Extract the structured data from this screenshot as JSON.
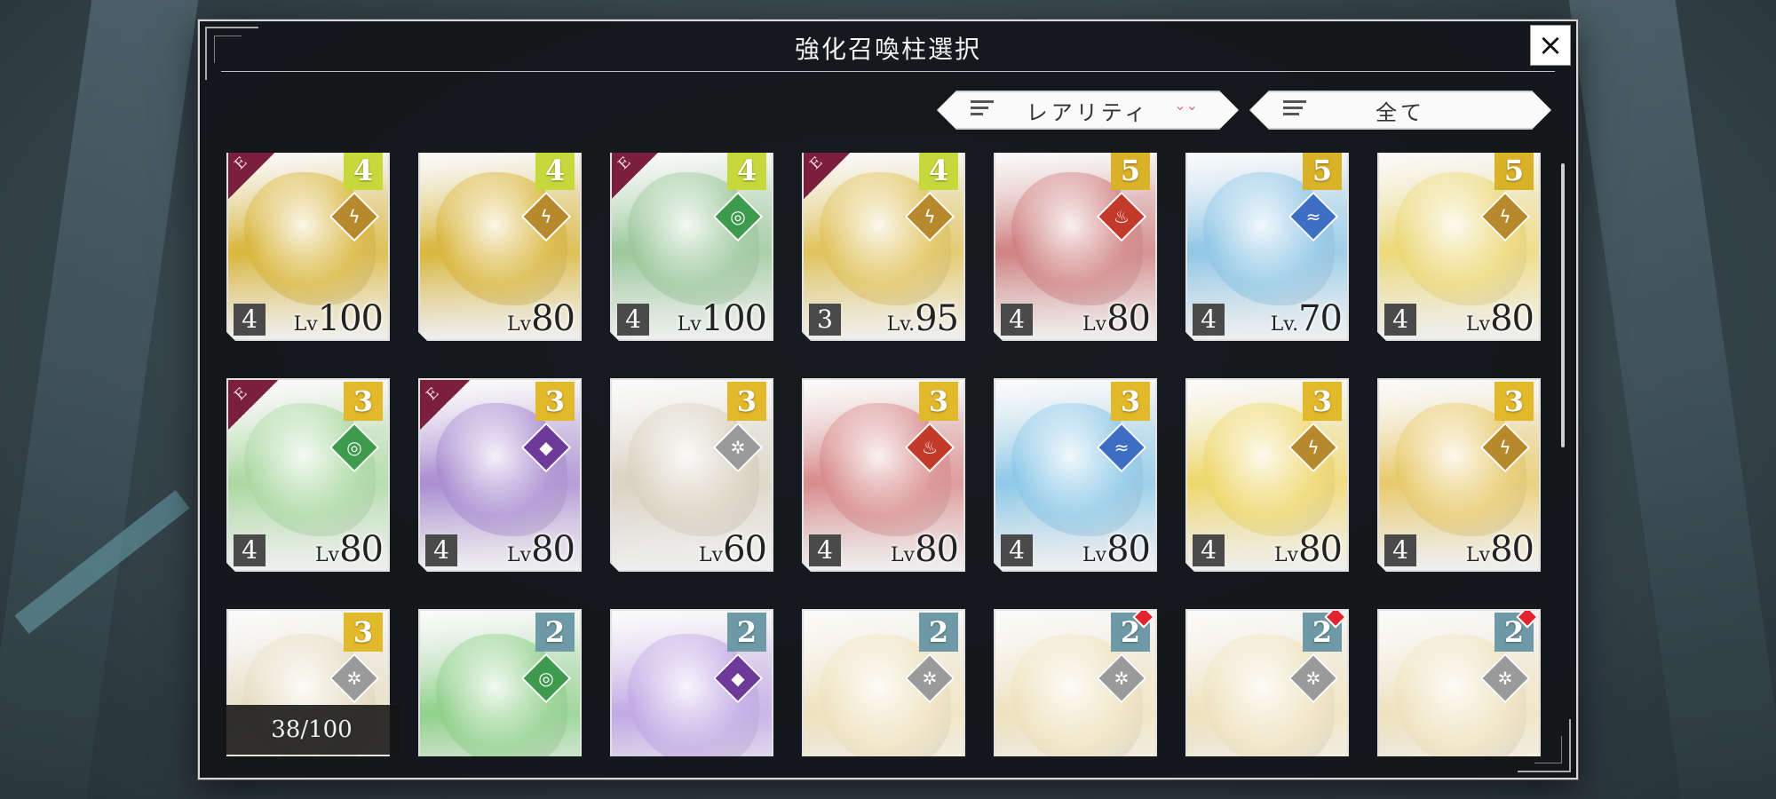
{
  "dialog": {
    "title": "強化召喚柱選択",
    "close_label": "×",
    "sort_label": "レアリティ",
    "sort_chevron": "⌄⌄",
    "filter_label": "全て",
    "counter": "38/100"
  },
  "colors": {
    "rarity4": "#c7d83a",
    "rarity5": "#d9b227",
    "rarity3": "#e3b92c",
    "rarity2": "#6e9aa7",
    "elem_thunder": "#b5892c",
    "elem_wind": "#3e9a4c",
    "elem_fire": "#c33a2b",
    "elem_water": "#3c6fc4",
    "elem_dark": "#6d3a9a",
    "elem_neutral": "#9a9a9a"
  },
  "cards": [
    {
      "rarity": "4",
      "element": "thunder-icon",
      "elem_glyph": "ϟ",
      "e": "E",
      "count": "4",
      "lv_prefix": "Lv",
      "level": "100",
      "tone": "#d9b53a"
    },
    {
      "rarity": "4",
      "element": "thunder-icon",
      "elem_glyph": "ϟ",
      "e": "",
      "count": "",
      "lv_prefix": "Lv",
      "level": "80",
      "tone": "#d9b53a"
    },
    {
      "rarity": "4",
      "element": "wind-icon",
      "elem_glyph": "◎",
      "e": "E",
      "count": "4",
      "lv_prefix": "Lv",
      "level": "100",
      "tone": "#9ac79a"
    },
    {
      "rarity": "4",
      "element": "thunder-icon",
      "elem_glyph": "ϟ",
      "e": "E",
      "count": "3",
      "lv_prefix": "Lv.",
      "level": "95",
      "tone": "#e0c25a"
    },
    {
      "rarity": "5",
      "element": "fire-icon",
      "elem_glyph": "♨",
      "e": "",
      "count": "4",
      "lv_prefix": "Lv",
      "level": "80",
      "tone": "#d08080"
    },
    {
      "rarity": "5",
      "element": "water-icon",
      "elem_glyph": "≈",
      "e": "",
      "count": "4",
      "lv_prefix": "Lv.",
      "level": "70",
      "tone": "#8fc6e6"
    },
    {
      "rarity": "5",
      "element": "thunder-icon",
      "elem_glyph": "ϟ",
      "e": "",
      "count": "4",
      "lv_prefix": "Lv",
      "level": "80",
      "tone": "#ecd876"
    },
    {
      "rarity": "3",
      "element": "wind-icon",
      "elem_glyph": "◎",
      "e": "E",
      "count": "4",
      "lv_prefix": "Lv",
      "level": "80",
      "tone": "#a9d8a0"
    },
    {
      "rarity": "3",
      "element": "dark-icon",
      "elem_glyph": "◆",
      "e": "E",
      "count": "4",
      "lv_prefix": "Lv",
      "level": "80",
      "tone": "#a88bd0"
    },
    {
      "rarity": "3",
      "element": "neutral-icon",
      "elem_glyph": "✲",
      "e": "",
      "count": "",
      "lv_prefix": "Lv",
      "level": "60",
      "tone": "#d9d2c0"
    },
    {
      "rarity": "3",
      "element": "fire-icon",
      "elem_glyph": "♨",
      "e": "",
      "count": "4",
      "lv_prefix": "Lv",
      "level": "80",
      "tone": "#d88a8a"
    },
    {
      "rarity": "3",
      "element": "water-icon",
      "elem_glyph": "≈",
      "e": "",
      "count": "4",
      "lv_prefix": "Lv",
      "level": "80",
      "tone": "#8cc8e8"
    },
    {
      "rarity": "3",
      "element": "thunder-icon",
      "elem_glyph": "ϟ",
      "e": "",
      "count": "4",
      "lv_prefix": "Lv",
      "level": "80",
      "tone": "#eed76a"
    },
    {
      "rarity": "3",
      "element": "thunder-icon",
      "elem_glyph": "ϟ",
      "e": "",
      "count": "4",
      "lv_prefix": "Lv",
      "level": "80",
      "tone": "#e8c96a"
    },
    {
      "rarity": "3",
      "element": "neutral-icon",
      "elem_glyph": "✲",
      "e": "",
      "count": "",
      "lv_prefix": "",
      "level": "",
      "tone": "#e6dcc0"
    },
    {
      "rarity": "2",
      "element": "wind-icon",
      "elem_glyph": "◎",
      "e": "",
      "count": "",
      "lv_prefix": "",
      "level": "",
      "tone": "#8fd08a"
    },
    {
      "rarity": "2",
      "element": "dark-icon",
      "elem_glyph": "◆",
      "e": "",
      "count": "",
      "lv_prefix": "",
      "level": "",
      "tone": "#c0a8e4"
    },
    {
      "rarity": "2",
      "element": "neutral-icon",
      "elem_glyph": "✲",
      "e": "",
      "count": "",
      "lv_prefix": "",
      "level": "",
      "tone": "#efe2bd",
      "gem": false
    },
    {
      "rarity": "2",
      "element": "neutral-icon",
      "elem_glyph": "✲",
      "e": "",
      "count": "",
      "lv_prefix": "",
      "level": "",
      "tone": "#efe2bd",
      "gem": true
    },
    {
      "rarity": "2",
      "element": "neutral-icon",
      "elem_glyph": "✲",
      "e": "",
      "count": "",
      "lv_prefix": "",
      "level": "",
      "tone": "#efe2bd",
      "gem": true
    },
    {
      "rarity": "2",
      "element": "neutral-icon",
      "elem_glyph": "✲",
      "e": "",
      "count": "",
      "lv_prefix": "",
      "level": "",
      "tone": "#efe2bd",
      "gem": true
    }
  ]
}
